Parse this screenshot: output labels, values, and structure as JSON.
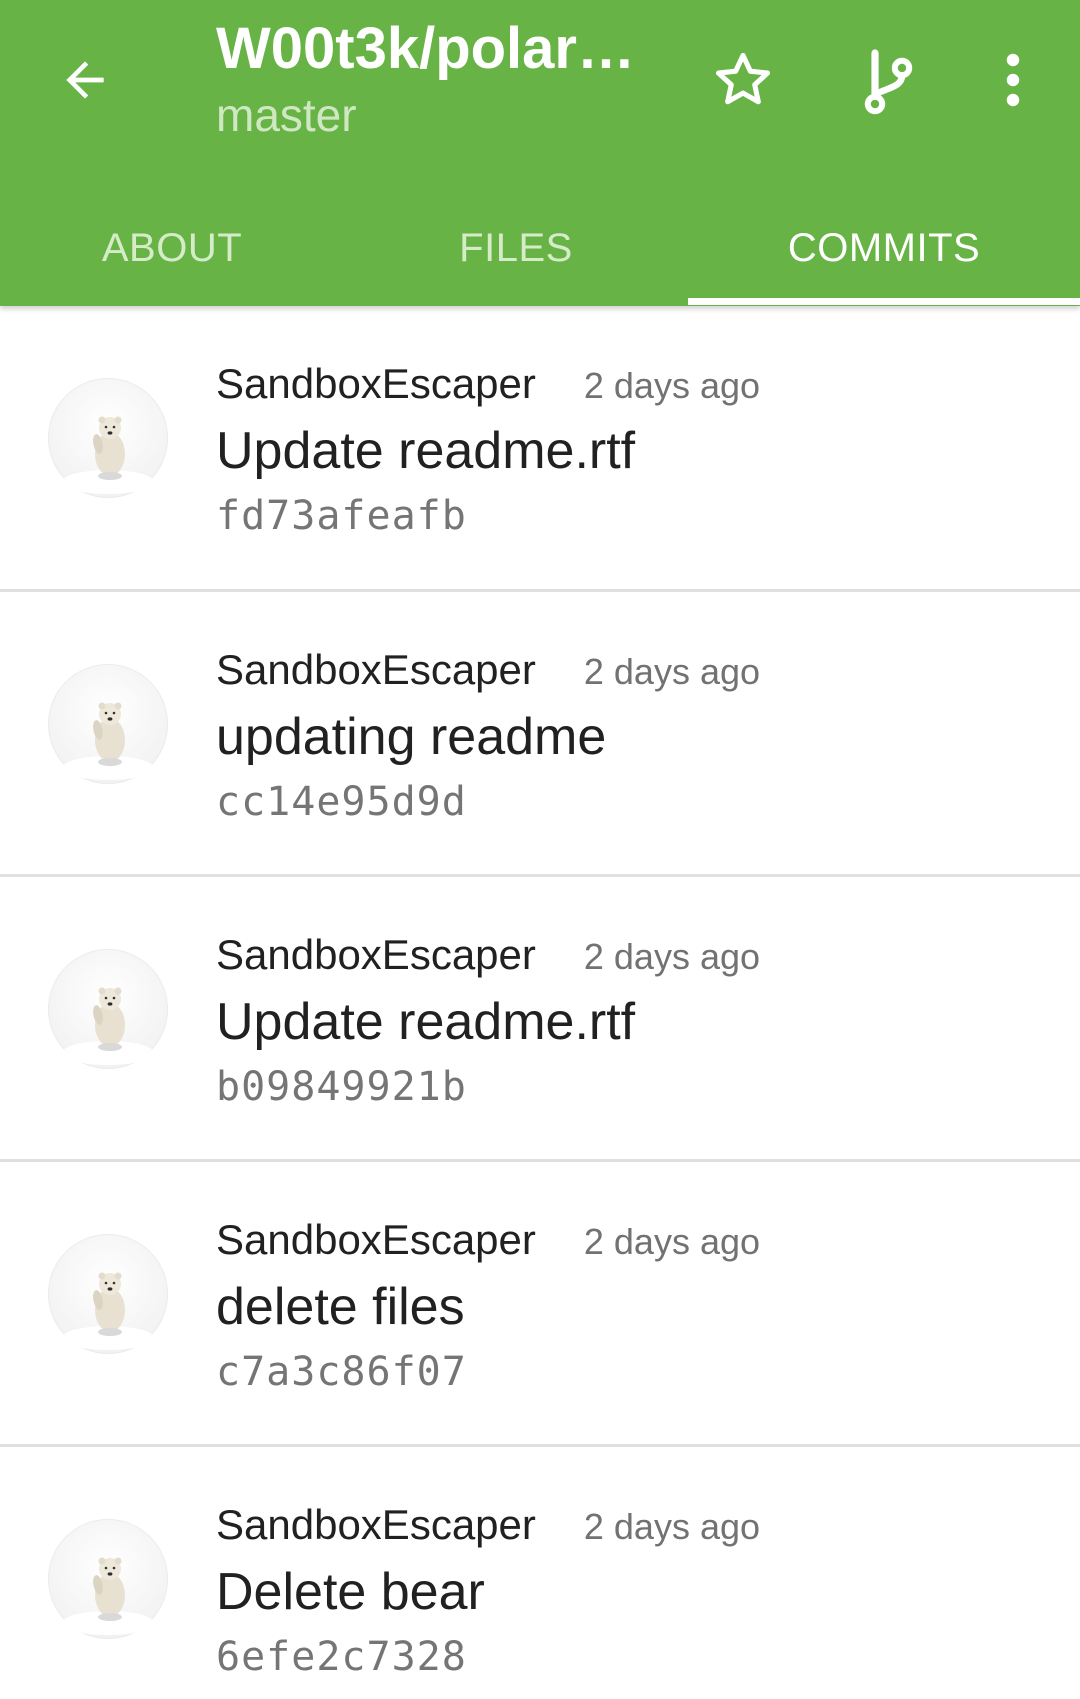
{
  "appbar": {
    "title": "W00t3k/polar…",
    "subtitle": "master",
    "back_icon": "arrow-left-icon",
    "star_icon": "star-outline-icon",
    "branch_icon": "git-branch-icon",
    "more_icon": "more-vertical-icon",
    "color": "#67b346"
  },
  "tabs": [
    {
      "label": "ABOUT",
      "active": false
    },
    {
      "label": "FILES",
      "active": false
    },
    {
      "label": "COMMITS",
      "active": true
    }
  ],
  "commits": [
    {
      "author": "SandboxEscaper",
      "time": "2 days ago",
      "message": "Update readme.rtf",
      "sha": "fd73afeafb"
    },
    {
      "author": "SandboxEscaper",
      "time": "2 days ago",
      "message": "updating readme",
      "sha": "cc14e95d9d"
    },
    {
      "author": "SandboxEscaper",
      "time": "2 days ago",
      "message": "Update readme.rtf",
      "sha": "b09849921b"
    },
    {
      "author": "SandboxEscaper",
      "time": "2 days ago",
      "message": "delete files",
      "sha": "c7a3c86f07"
    },
    {
      "author": "SandboxEscaper",
      "time": "2 days ago",
      "message": "Delete bear",
      "sha": "6efe2c7328"
    }
  ]
}
